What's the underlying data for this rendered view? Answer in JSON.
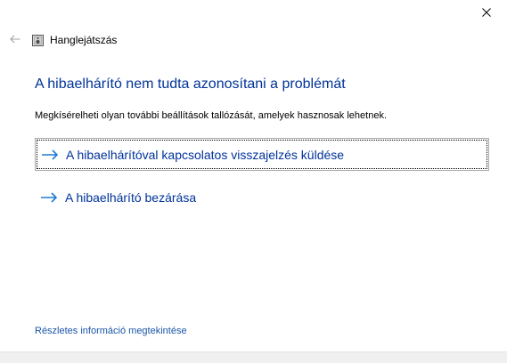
{
  "window": {
    "close_icon": "close-icon"
  },
  "titlebar": {
    "back_icon": "back-arrow-icon",
    "app_icon": "audio-device-icon",
    "title": "Hanglejátszás"
  },
  "main": {
    "heading": "A hibaelhárító nem tudta azonosítani a problémát",
    "description": "Megkísérelheti olyan további beállítások tallózását, amelyek hasznosak lehetnek.",
    "options": [
      {
        "label": "A hibaelhárítóval kapcsolatos visszajelzés küldése",
        "icon": "arrow-right-icon",
        "focused": true
      },
      {
        "label": "A hibaelhárító bezárása",
        "icon": "arrow-right-icon",
        "focused": false
      }
    ],
    "details_link": "Részletes információ megtekintése"
  },
  "colors": {
    "heading": "#003399",
    "link": "#1a56a8",
    "arrow": "#1e7bd4"
  }
}
